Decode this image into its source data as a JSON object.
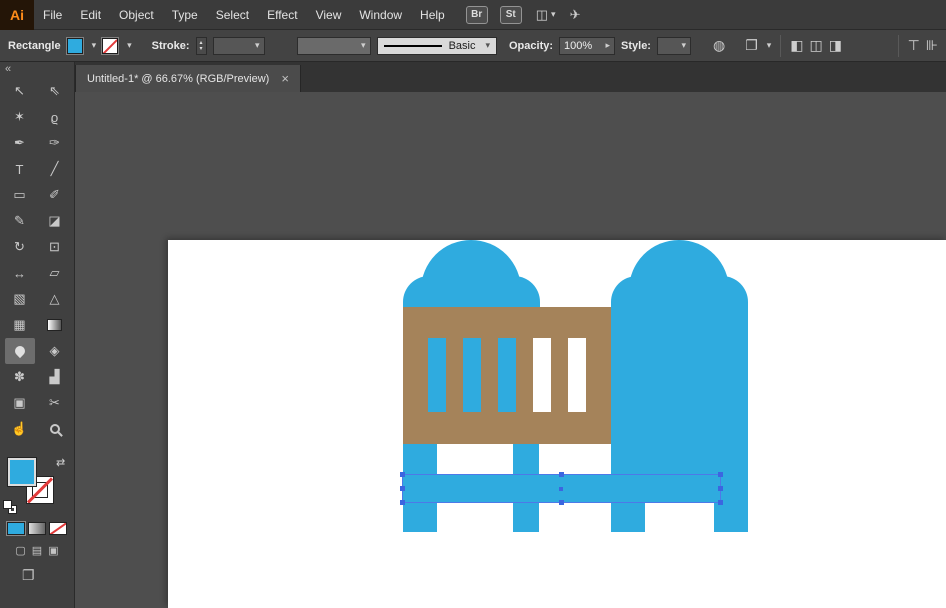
{
  "menubar": {
    "logo_text": "Ai",
    "items": [
      "File",
      "Edit",
      "Object",
      "Type",
      "Select",
      "Effect",
      "View",
      "Window",
      "Help"
    ],
    "bridge_label": "Br",
    "stock_label": "St",
    "workspace_glyph": "◫",
    "caret_glyph": "▾",
    "gpu_glyph": "✈"
  },
  "controlbar": {
    "selection_type": "Rectangle",
    "caret": "▾",
    "stroke_label": "Stroke:",
    "stepper_up": "▴",
    "stepper_down": "▾",
    "brush_name": "Basic",
    "opacity_label": "Opacity:",
    "opacity_value": "100%",
    "opacity_caret": "▸",
    "style_label": "Style:",
    "globe_glyph": "◍",
    "doc_glyph": "❐",
    "align_left_glyph": "◧",
    "align_center_glyph": "◫",
    "align_right_glyph": "◨",
    "valign_glyph": "⊤",
    "distribute_glyph": "⊪"
  },
  "tabbar": {
    "collapse_glyph": "«",
    "tab_title": "Untitled-1* @ 66.67% (RGB/Preview)",
    "close_glyph": "×"
  },
  "tools": [
    {
      "name": "selection",
      "glyph": "↖"
    },
    {
      "name": "direct-selection",
      "glyph": "⇖"
    },
    {
      "name": "magic-wand",
      "glyph": "✶"
    },
    {
      "name": "lasso",
      "glyph": "ϱ"
    },
    {
      "name": "pen",
      "glyph": "✒"
    },
    {
      "name": "curvature",
      "glyph": "✑"
    },
    {
      "name": "type",
      "glyph": "T"
    },
    {
      "name": "line-segment",
      "glyph": "╱"
    },
    {
      "name": "rectangle",
      "glyph": "▭"
    },
    {
      "name": "paintbrush",
      "glyph": "✐"
    },
    {
      "name": "pencil",
      "glyph": "✎"
    },
    {
      "name": "eraser",
      "glyph": "◪"
    },
    {
      "name": "rotate",
      "glyph": "↻"
    },
    {
      "name": "scale",
      "glyph": "⊡"
    },
    {
      "name": "width",
      "glyph": "↔"
    },
    {
      "name": "free-transform",
      "glyph": "▱"
    },
    {
      "name": "shape-builder",
      "glyph": "▧"
    },
    {
      "name": "perspective-grid",
      "glyph": "△"
    },
    {
      "name": "mesh",
      "glyph": "▦"
    },
    {
      "name": "gradient",
      "glyph": ""
    },
    {
      "name": "eyedropper",
      "glyph": "",
      "selected": true
    },
    {
      "name": "blend",
      "glyph": "◈"
    },
    {
      "name": "symbol-sprayer",
      "glyph": "✽"
    },
    {
      "name": "column-graph",
      "glyph": "▟"
    },
    {
      "name": "artboard",
      "glyph": "▣"
    },
    {
      "name": "slice",
      "glyph": "✂"
    },
    {
      "name": "hand",
      "glyph": "☝"
    },
    {
      "name": "zoom",
      "glyph": ""
    }
  ],
  "fillstroke": {
    "swap_glyph": "⇄",
    "mode_normal_glyph": "▢",
    "mode_behind_glyph": "▤",
    "mode_inside_glyph": "▣",
    "screen_mode_glyph": "❐"
  },
  "colors": {
    "artwork_blue": "#2fabdf",
    "artwork_brown": "#a5835a",
    "selection_blue": "#3b66e0",
    "current_fill": "#2fabdf",
    "current_stroke": "none"
  }
}
